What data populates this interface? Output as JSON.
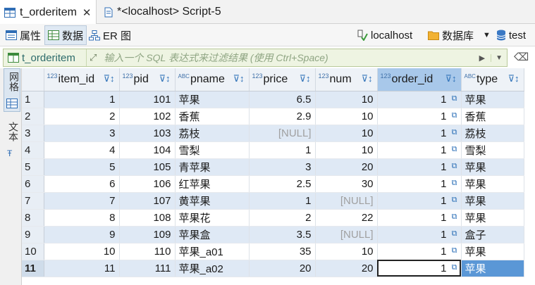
{
  "tabs": [
    {
      "label": "t_orderitem",
      "close": "✕"
    },
    {
      "label": "*<localhost> Script-5"
    }
  ],
  "toolbar": {
    "properties_label": "属性",
    "data_label": "数据",
    "er_label": "ER 图",
    "connection_label": "localhost",
    "database_label": "数据库",
    "schema_label": "test"
  },
  "filter": {
    "table_label": "t_orderitem",
    "placeholder": "输入一个 SQL 表达式来过滤结果 (使用 Ctrl+Space)"
  },
  "sidebar": {
    "grid_label": "网格",
    "text_label": "文本"
  },
  "grid": {
    "type_num": "123",
    "type_text": "ABC",
    "columns": [
      {
        "name": "item_id"
      },
      {
        "name": "pid"
      },
      {
        "name": "pname"
      },
      {
        "name": "price"
      },
      {
        "name": "num"
      },
      {
        "name": "order_id"
      },
      {
        "name": "type"
      }
    ],
    "rows": [
      [
        "1",
        "1",
        "101",
        "苹果",
        "6.5",
        "10",
        "1",
        "苹果"
      ],
      [
        "2",
        "2",
        "102",
        "香蕉",
        "2.9",
        "10",
        "1",
        "香蕉"
      ],
      [
        "3",
        "3",
        "103",
        "荔枝",
        "[NULL]",
        "10",
        "1",
        "荔枝"
      ],
      [
        "4",
        "4",
        "104",
        "雪梨",
        "1",
        "10",
        "1",
        "雪梨"
      ],
      [
        "5",
        "5",
        "105",
        "青苹果",
        "3",
        "20",
        "1",
        "苹果"
      ],
      [
        "6",
        "6",
        "106",
        "红苹果",
        "2.5",
        "30",
        "1",
        "苹果"
      ],
      [
        "7",
        "7",
        "107",
        "黄苹果",
        "1",
        "[NULL]",
        "1",
        "苹果"
      ],
      [
        "8",
        "8",
        "108",
        "苹果花",
        "2",
        "22",
        "1",
        "苹果"
      ],
      [
        "9",
        "9",
        "109",
        "苹果盒",
        "3.5",
        "[NULL]",
        "1",
        "盒子"
      ],
      [
        "10",
        "10",
        "110",
        "苹果_a01",
        "35",
        "10",
        "1",
        "苹果"
      ],
      [
        "11",
        "11",
        "111",
        "苹果_a02",
        "20",
        "20",
        "1",
        "苹果"
      ]
    ]
  }
}
